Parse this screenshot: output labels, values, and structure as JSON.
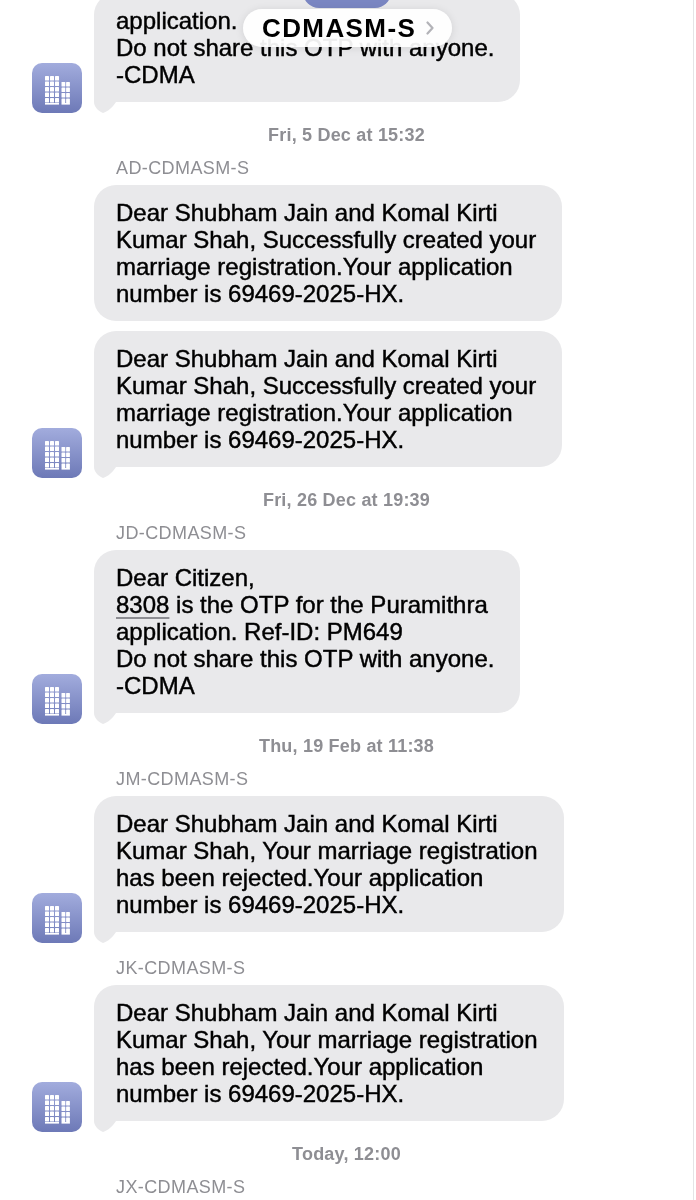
{
  "header": {
    "contact_name": "CDMASM-S"
  },
  "groups": [
    {
      "messages": [
        {
          "paragraphs": [
            [
              {
                "kind": "text",
                "text": "application."
              }
            ],
            [
              {
                "kind": "text",
                "text": "Do not share this OTP with anyone."
              }
            ],
            [
              {
                "kind": "text",
                "text": "-CDMA"
              }
            ]
          ]
        }
      ]
    },
    {
      "timestamp": "Fri, 5 Dec at 15:32",
      "sender": "AD-CDMASM-S",
      "messages": [
        {
          "paragraphs": [
            [
              {
                "kind": "text",
                "text": "Dear Shubham Jain and Komal Kirti\nKumar Shah, Successfully created your\nmarriage registration.Your application\nnumber is 69469-2025-HX."
              }
            ]
          ]
        },
        {
          "paragraphs": [
            [
              {
                "kind": "text",
                "text": "Dear Shubham Jain and Komal Kirti\nKumar Shah, Successfully created your\nmarriage registration.Your application\nnumber is 69469-2025-HX."
              }
            ]
          ]
        }
      ]
    },
    {
      "timestamp": "Fri, 26 Dec at 19:39",
      "sender": "JD-CDMASM-S",
      "messages": [
        {
          "paragraphs": [
            [
              {
                "kind": "text",
                "text": "Dear Citizen,"
              }
            ],
            [
              {
                "kind": "code",
                "text": "8308"
              },
              {
                "kind": "text",
                "text": " is the OTP for the Puramithra\napplication. Ref-ID: PM649"
              }
            ],
            [
              {
                "kind": "text",
                "text": "Do not share this OTP with anyone."
              }
            ],
            [
              {
                "kind": "text",
                "text": "-CDMA"
              }
            ]
          ]
        }
      ]
    },
    {
      "timestamp": "Thu, 19 Feb at 11:38",
      "sender": "JM-CDMASM-S",
      "messages": [
        {
          "paragraphs": [
            [
              {
                "kind": "text",
                "text": "Dear Shubham Jain and Komal Kirti\nKumar Shah, Your marriage registration\nhas been rejected.Your application\nnumber is 69469-2025-HX."
              }
            ]
          ]
        }
      ]
    },
    {
      "sender": "JK-CDMASM-S",
      "messages": [
        {
          "paragraphs": [
            [
              {
                "kind": "text",
                "text": "Dear Shubham Jain and Komal Kirti\nKumar Shah, Your marriage registration\nhas been rejected.Your application\nnumber is 69469-2025-HX."
              }
            ]
          ]
        }
      ]
    },
    {
      "timestamp": "Today, 12:00",
      "sender": "JX-CDMASM-S"
    }
  ]
}
